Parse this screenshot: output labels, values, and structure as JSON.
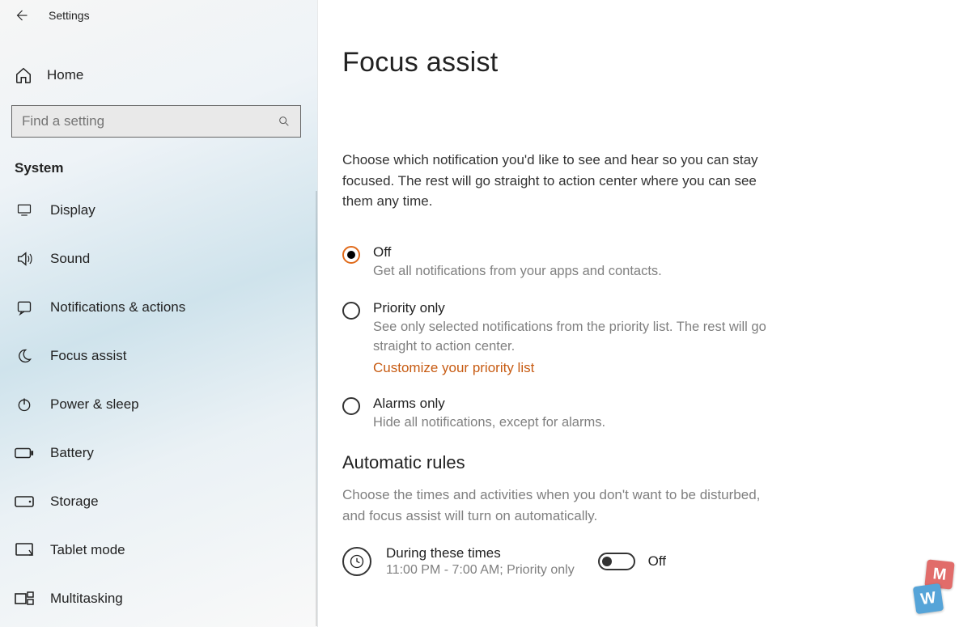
{
  "app_title": "Settings",
  "home_label": "Home",
  "search_placeholder": "Find a setting",
  "section_label": "System",
  "nav": [
    {
      "label": "Display"
    },
    {
      "label": "Sound"
    },
    {
      "label": "Notifications & actions"
    },
    {
      "label": "Focus assist"
    },
    {
      "label": "Power & sleep"
    },
    {
      "label": "Battery"
    },
    {
      "label": "Storage"
    },
    {
      "label": "Tablet mode"
    },
    {
      "label": "Multitasking"
    }
  ],
  "page_title": "Focus assist",
  "intro": "Choose which notification you'd like to see and hear so you can stay focused. The rest will go straight to action center where you can see them any time.",
  "options": {
    "off": {
      "title": "Off",
      "desc": "Get all notifications from your apps and contacts."
    },
    "priority": {
      "title": "Priority only",
      "desc": "See only selected notifications from the priority list. The rest will go straight to action center.",
      "link": "Customize your priority list"
    },
    "alarms": {
      "title": "Alarms only",
      "desc": "Hide all notifications, except for alarms."
    }
  },
  "rules": {
    "heading": "Automatic rules",
    "desc": "Choose the times and activities when you don't want to be disturbed, and focus assist will turn on automatically.",
    "item": {
      "title": "During these times",
      "sub": "11:00 PM - 7:00 AM; Priority only"
    },
    "toggle_label": "Off"
  },
  "watermark": {
    "letters": [
      "M",
      "W"
    ]
  }
}
